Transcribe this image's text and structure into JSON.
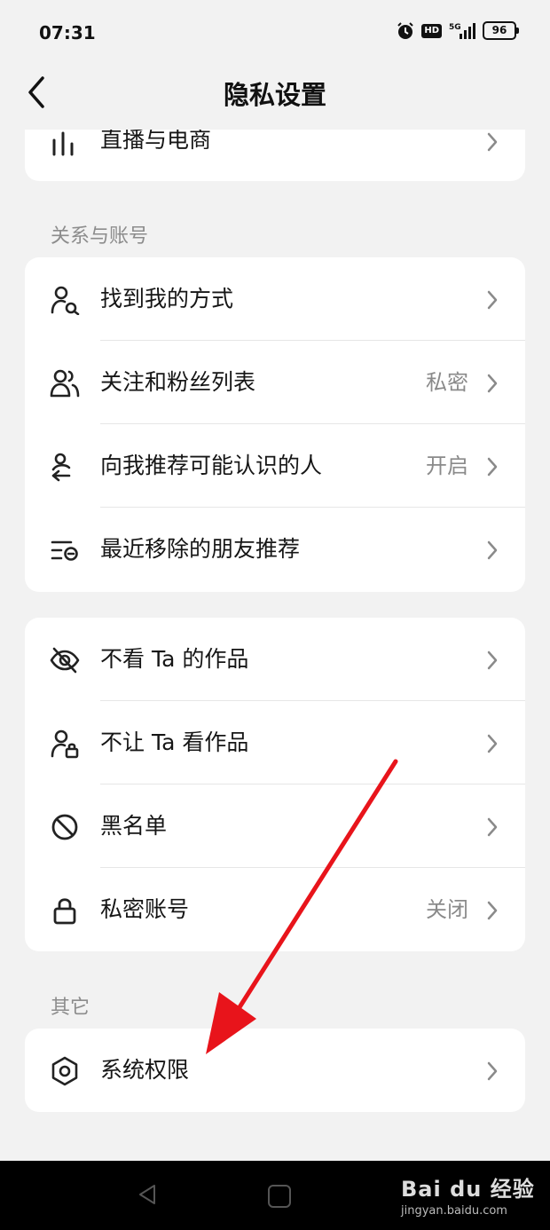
{
  "status_bar": {
    "time": "07:31",
    "hd": "HD",
    "network": "5G",
    "battery": "96"
  },
  "header": {
    "title": "隐私设置"
  },
  "top_card": {
    "label": "直播与电商"
  },
  "section_relations": {
    "title": "关系与账号",
    "items": [
      {
        "label": "找到我的方式",
        "value": ""
      },
      {
        "label": "关注和粉丝列表",
        "value": "私密"
      },
      {
        "label": "向我推荐可能认识的人",
        "value": "开启"
      },
      {
        "label": "最近移除的朋友推荐",
        "value": ""
      }
    ]
  },
  "section_block": {
    "items": [
      {
        "label": "不看 Ta 的作品",
        "value": ""
      },
      {
        "label": "不让 Ta 看作品",
        "value": ""
      },
      {
        "label": "黑名单",
        "value": ""
      },
      {
        "label": "私密账号",
        "value": "关闭"
      }
    ]
  },
  "section_other": {
    "title": "其它",
    "items": [
      {
        "label": "系统权限",
        "value": ""
      }
    ]
  },
  "watermark": {
    "brand": "Bai du 经验",
    "url": "jingyan.baidu.com"
  },
  "colors": {
    "background": "#f2f2f2",
    "card": "#ffffff",
    "annotation_arrow": "#e8141b"
  }
}
